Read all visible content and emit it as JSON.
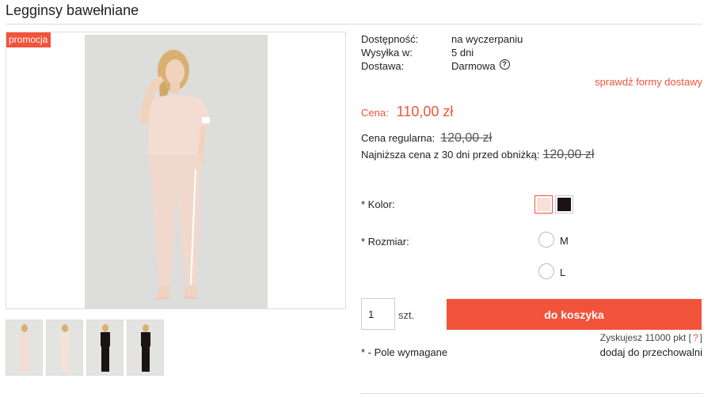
{
  "product": {
    "title": "Legginsy bawełniane",
    "badge": "promocja",
    "thumbnails": [
      {
        "outfit_color": "#f2ddd4"
      },
      {
        "outfit_color": "#f4e2d6"
      },
      {
        "outfit_color": "#1a1416"
      },
      {
        "outfit_color": "#1a1416"
      }
    ]
  },
  "info": {
    "availability_label": "Dostępność:",
    "availability_value": "na wyczerpaniu",
    "shipping_label": "Wysyłka w:",
    "shipping_value": "5 dni",
    "delivery_label": "Dostawa:",
    "delivery_value": "Darmowa",
    "help_glyph": "?",
    "shipping_link": "sprawdź formy dostawy"
  },
  "price": {
    "label": "Cena:",
    "value": "110,00 zł",
    "regular_label": "Cena regularna:",
    "regular_value": "120,00 zł",
    "lowest_label": "Najniższa cena z 30 dni przed obniżką:",
    "lowest_value": "120,00 zł"
  },
  "options": {
    "color_label": "* Kolor:",
    "colors": [
      "#f6e0d8",
      "#1c1214"
    ],
    "selected_color": 0,
    "size_label": "* Rozmiar:",
    "sizes": [
      "M",
      "L"
    ]
  },
  "cart": {
    "quantity": "1",
    "unit": "szt.",
    "button": "do koszyka",
    "points_text": "Zyskujesz 11000 pkt [",
    "points_help": "?",
    "points_close": "]",
    "required_note": "* - Pole wymagane",
    "store_link": "dodaj do przechowalni"
  },
  "colors": {
    "accent": "#f2533b",
    "outfit_pink": "#f3ddd2"
  }
}
